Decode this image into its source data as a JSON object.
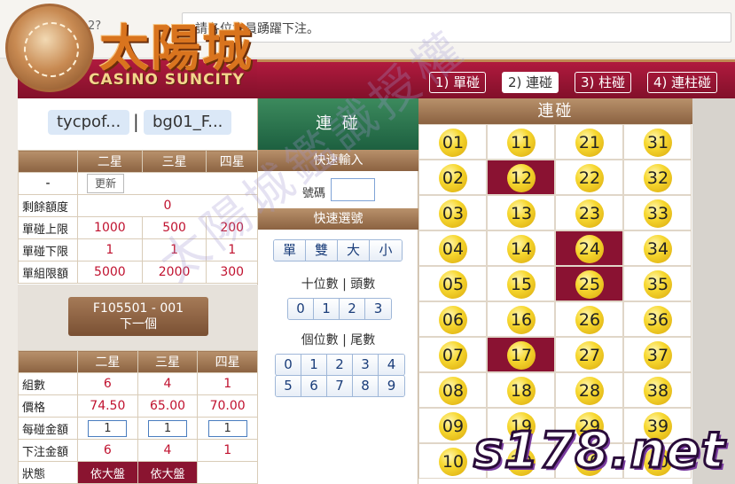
{
  "marquee": {
    "date": "2021-01-2?",
    "text": "請各位會員踴躍下注。"
  },
  "logo": {
    "chinese": "太陽城",
    "english": "CASINO SUNCITY"
  },
  "tabs": [
    {
      "label": "1) 單碰"
    },
    {
      "label": "2) 連碰",
      "active": true
    },
    {
      "label": "3) 柱碰"
    },
    {
      "label": "4) 連柱碰"
    }
  ],
  "accounts": {
    "left": "tycpof...",
    "separator": "|",
    "right": "bg01_F..."
  },
  "limits": {
    "headers": [
      "",
      "二星",
      "三星",
      "四星"
    ],
    "refresh_row_label": "-",
    "refresh_button": "更新",
    "rows": [
      {
        "label": "剩餘額度",
        "value": "0"
      },
      {
        "label": "單碰上限",
        "values": [
          "1000",
          "500",
          "200"
        ]
      },
      {
        "label": "單碰下限",
        "values": [
          "1",
          "1",
          "1"
        ]
      },
      {
        "label": "單組限額",
        "values": [
          "5000",
          "2000",
          "300"
        ]
      }
    ]
  },
  "next": {
    "code": "F105501 - 001",
    "label": "下一個"
  },
  "bet": {
    "headers": [
      "",
      "二星",
      "三星",
      "四星"
    ],
    "groups_label": "組數",
    "groups": [
      "6",
      "4",
      "1"
    ],
    "price_label": "價格",
    "prices": [
      "74.50",
      "65.00",
      "70.00"
    ],
    "each_label": "每碰金額",
    "each": [
      "1",
      "1",
      "1"
    ],
    "total_label": "下注金額",
    "totals": [
      "6",
      "4",
      "1"
    ],
    "status_label": "狀態",
    "status": [
      "依大盤",
      "依大盤",
      ""
    ]
  },
  "middle": {
    "title": "連 碰",
    "quick_input": "快速輸入",
    "code_label": "號碼",
    "quick_select": "快速選號",
    "type_buttons": [
      "單",
      "雙",
      "大",
      "小"
    ],
    "tens_label": "十位數 | 頭數",
    "tens_buttons": [
      "0",
      "1",
      "2",
      "3"
    ],
    "units_label": "個位數 | 尾數",
    "units_row1": [
      "0",
      "1",
      "2",
      "3",
      "4"
    ],
    "units_row2": [
      "5",
      "6",
      "7",
      "8",
      "9"
    ]
  },
  "board": {
    "title": "連碰",
    "numbers": [
      "01",
      "11",
      "21",
      "31",
      "02",
      "12",
      "22",
      "32",
      "03",
      "13",
      "23",
      "33",
      "04",
      "14",
      "24",
      "34",
      "05",
      "15",
      "25",
      "35",
      "06",
      "16",
      "26",
      "36",
      "07",
      "17",
      "27",
      "37",
      "08",
      "18",
      "28",
      "38",
      "09",
      "19",
      "29",
      "39",
      "10",
      "20",
      "30",
      "40"
    ],
    "selected": [
      "12",
      "17",
      "24",
      "25"
    ]
  },
  "watermark": {
    "diagonal": "太陽城鑑識授權",
    "site": "s178.net"
  },
  "colors": {
    "burgundy": "#8a1232",
    "tan_header": "#8b6241",
    "green_title": "#1d6040",
    "ball_yellow": "#f7d830"
  }
}
